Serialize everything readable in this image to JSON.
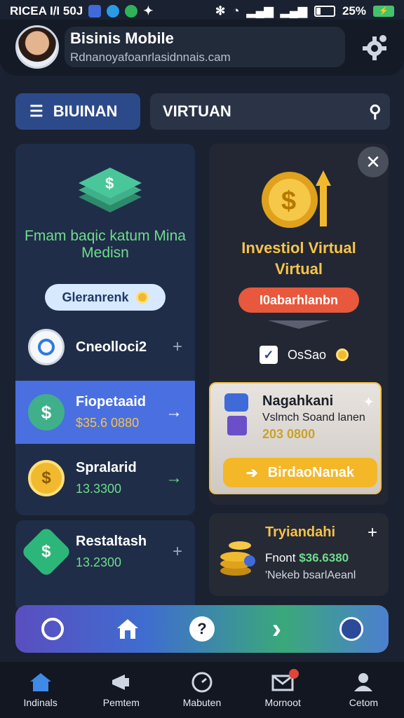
{
  "status_bar": {
    "left_text": "RICEA I/I 50J",
    "battery_percent": "25%"
  },
  "profile": {
    "name": "Bisinis Mobile",
    "email": "Rdnanoyafoanrlasidnnais.cam"
  },
  "toolbar": {
    "menu_label": "BIUINAN",
    "search_value": "VIRTUAN"
  },
  "left_panel": {
    "promo_text": "Fmam baqic katum Mina Medisn",
    "pill_label": "Gleranrenk",
    "items": [
      {
        "title": "Cneolloci2",
        "subtitle": ""
      },
      {
        "title": "Fiopetaaid",
        "subtitle": "$35.6 0880"
      },
      {
        "title": "Spralarid",
        "subtitle": "13.3300"
      },
      {
        "title": "Restaltash",
        "subtitle": "13.2300"
      }
    ]
  },
  "invest_card": {
    "title_line1": "Investiol Virtual",
    "title_line2": "Virtual",
    "red_pill": "I0abarhlanbn",
    "small_label": "OsSao",
    "promo_title": "Nagahkani",
    "promo_subtitle": "Vslmch Soand lanen",
    "promo_value": "203 0800",
    "cta_label": "BirdaoNanak"
  },
  "second_card": {
    "title": "Tryiandahi",
    "line1_label": "Fnont",
    "line1_value": "$36.6380",
    "line2": "'Nekeb bsarlAeanl"
  },
  "bottom_nav": [
    {
      "label": "Indinals",
      "icon": "home-icon"
    },
    {
      "label": "Pemtem",
      "icon": "megaphone-icon"
    },
    {
      "label": "Mabuten",
      "icon": "clock-icon"
    },
    {
      "label": "Mornoot",
      "icon": "mail-icon"
    },
    {
      "label": "Cetom",
      "icon": "user-icon"
    }
  ],
  "colors": {
    "accent_blue": "#4a6fe0",
    "gold": "#f7c44a",
    "green": "#6fdc8c",
    "red": "#e8583c"
  }
}
